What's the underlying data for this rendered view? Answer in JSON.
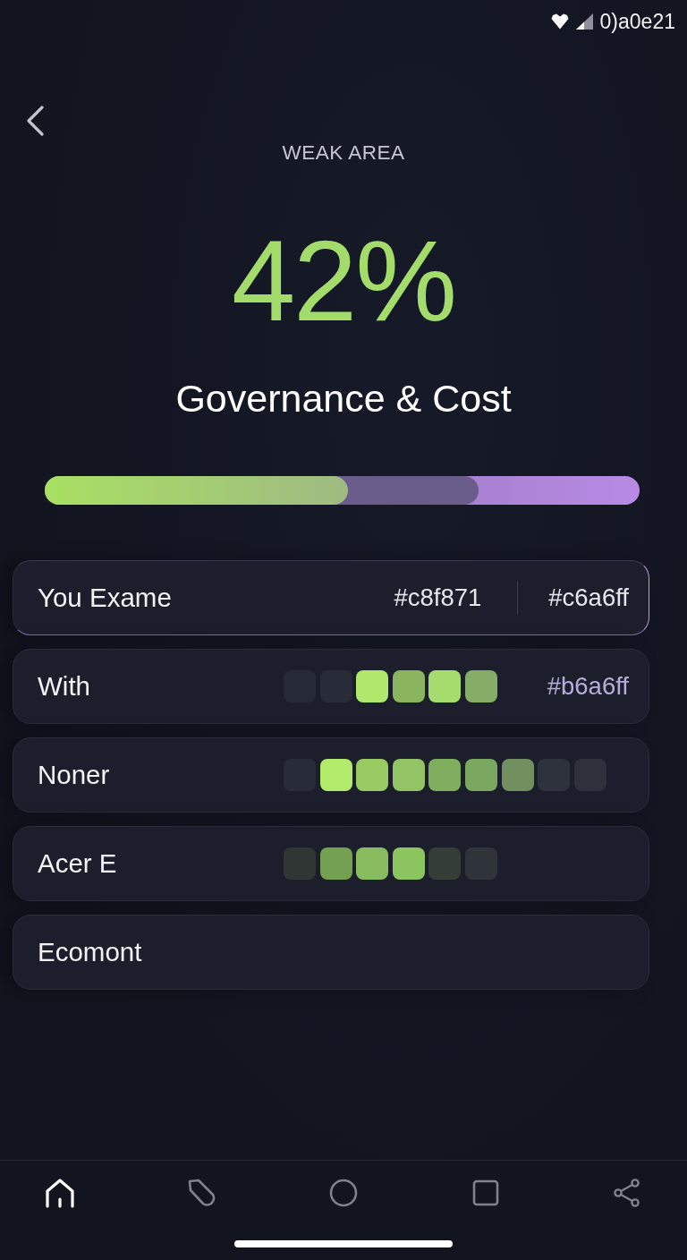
{
  "status_bar": {
    "time": "0)a0e21"
  },
  "header": {
    "eyebrow": "WEAK AREA",
    "score": "42%",
    "title": "Governance & Cost"
  },
  "progress": {
    "segments": [
      {
        "level": 0.51,
        "color": "#a8e063"
      },
      {
        "level": 0.73,
        "color": "#6a5d8c"
      }
    ]
  },
  "rows": [
    {
      "kind": "compare",
      "label": "You Exame",
      "selected": true,
      "values": [
        "#c8f871",
        "#c6a6ff"
      ]
    },
    {
      "kind": "cells",
      "label": "With",
      "selected": false,
      "cells": [
        {
          "color": "#262a38"
        },
        {
          "color": "#282c39"
        },
        {
          "color": "#b0e86c"
        },
        {
          "color": "#8ab45e"
        },
        {
          "color": "#a6dc6e"
        },
        {
          "color": "#86ad68"
        }
      ],
      "note": "#b6a6ff"
    },
    {
      "kind": "cells",
      "label": "Noner",
      "selected": false,
      "cells": [
        {
          "color": "#282c39"
        },
        {
          "color": "#b2ea6c"
        },
        {
          "color": "#98cc62"
        },
        {
          "color": "#92c466"
        },
        {
          "color": "#7fae5e"
        },
        {
          "color": "#7aa860"
        },
        {
          "color": "#728f60"
        },
        {
          "color": "#2e323c"
        },
        {
          "color": "#2e313c"
        }
      ]
    },
    {
      "kind": "cells",
      "label": "Acer E",
      "selected": false,
      "cells": [
        {
          "color": "#2f3633"
        },
        {
          "color": "#74a052"
        },
        {
          "color": "#88bc5e"
        },
        {
          "color": "#8cc460"
        },
        {
          "color": "#353d37"
        },
        {
          "color": "#2f333a"
        }
      ]
    },
    {
      "kind": "plain",
      "label": "Ecomont",
      "selected": false
    }
  ],
  "nav": [
    {
      "kind": "home",
      "selected": true
    },
    {
      "kind": "tag",
      "selected": false
    },
    {
      "kind": "circle",
      "selected": false
    },
    {
      "kind": "square",
      "selected": false
    },
    {
      "kind": "share",
      "selected": false
    }
  ]
}
